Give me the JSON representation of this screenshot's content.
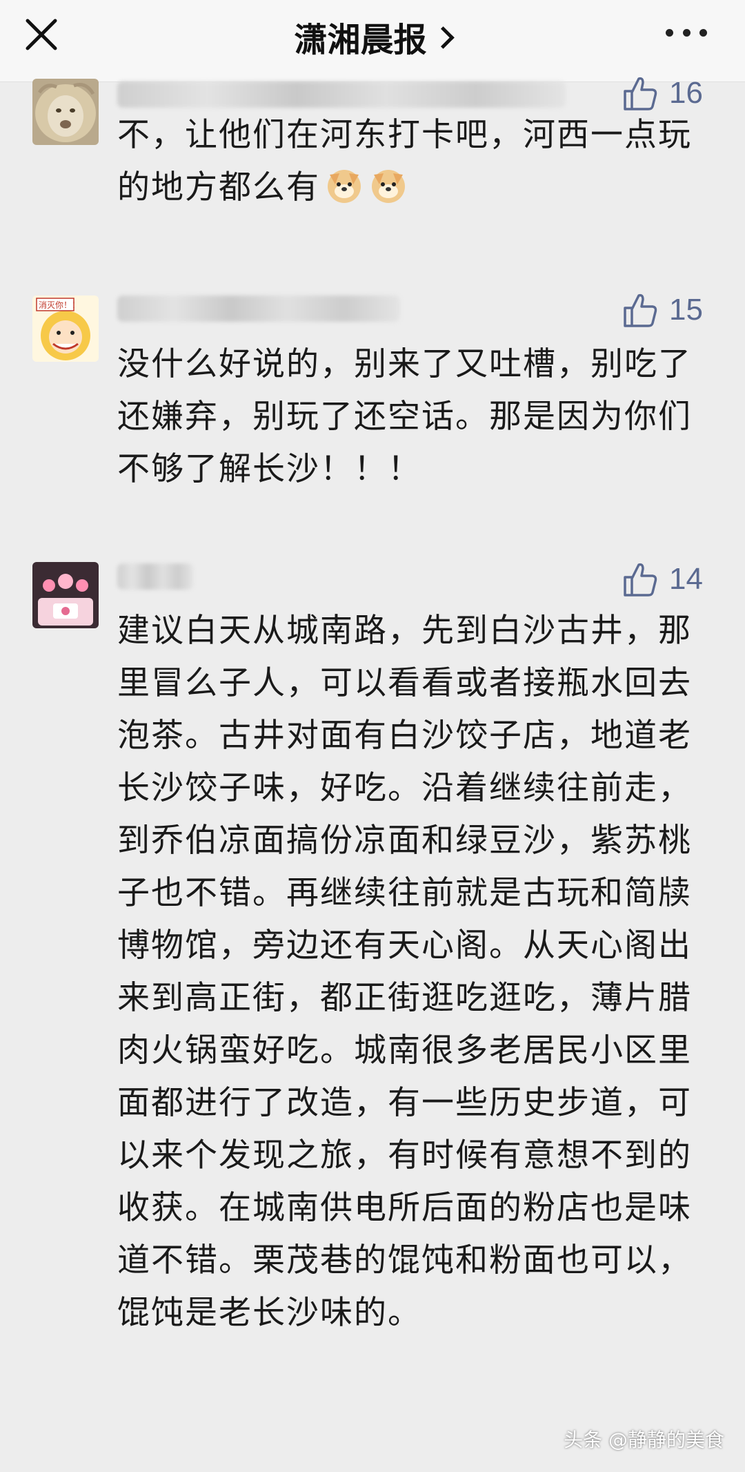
{
  "header": {
    "title": "潇湘晨报",
    "close_icon": "close-icon",
    "more_icon": "more-icon"
  },
  "comments": [
    {
      "likes": "16",
      "text": "不，让他们在河东打卡吧，河西一点玩的地方都么有"
    },
    {
      "likes": "15",
      "text": "没什么好说的，别来了又吐槽，别吃了还嫌弃，别玩了还空话。那是因为你们不够了解长沙！！！"
    },
    {
      "likes": "14",
      "text": "建议白天从城南路，先到白沙古井，那里冒么子人，可以看看或者接瓶水回去泡茶。古井对面有白沙饺子店，地道老长沙饺子味，好吃。沿着继续往前走，到乔伯凉面搞份凉面和绿豆沙，紫苏桃子也不错。再继续往前就是古玩和简牍博物馆，旁边还有天心阁。从天心阁出来到高正街，都正街逛吃逛吃，薄片腊肉火锅蛮好吃。城南很多老居民小区里面都进行了改造，有一些历史步道，可以来个发现之旅，有时候有意想不到的收获。在城南供电所后面的粉店也是味道不错。栗茂巷的馄饨和粉面也可以，馄饨是老长沙味的。"
    }
  ],
  "avatar2_label": "消灭你！！",
  "watermark": "头条 @静静的美食",
  "colors": {
    "like_color": "#5b6a91",
    "background": "#ededed"
  }
}
